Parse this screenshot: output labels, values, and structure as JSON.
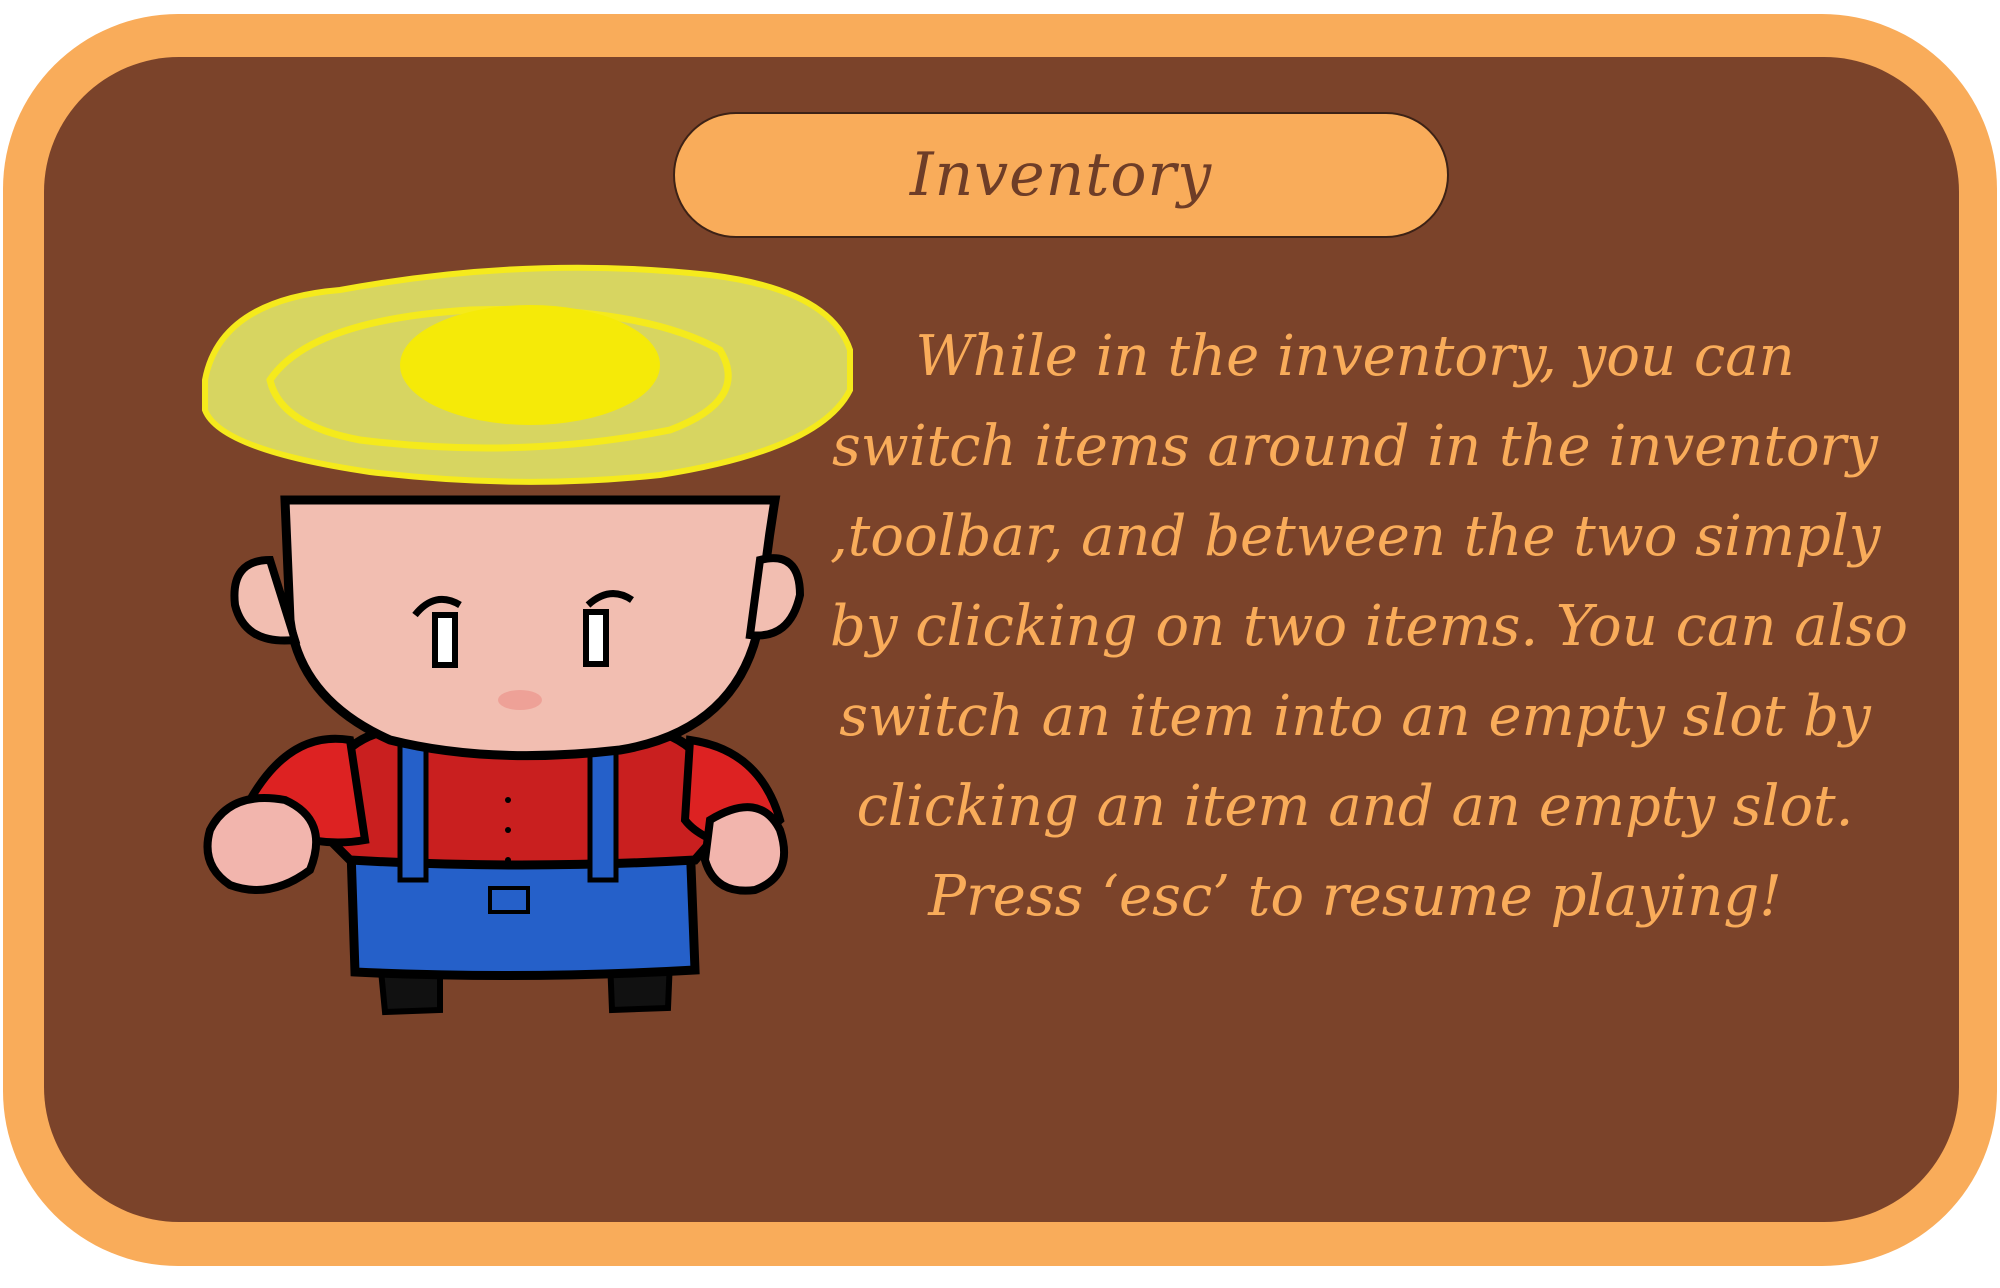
{
  "dialog": {
    "title": "Inventory",
    "lines": [
      "While in the inventory, you can",
      "switch items around in the inventory",
      ",toolbar, and between the two simply",
      "by clicking on two items. You can also",
      "switch an item into an empty slot by",
      "clicking an item and an empty slot.",
      "Press ‘esc’ to resume playing!"
    ]
  },
  "colors": {
    "frame": "#f9ac5a",
    "panel": "#7b432a",
    "text": "#f9ac5a",
    "title_text": "#6e3d27"
  },
  "illustration": {
    "icon": "farmer-character-icon"
  }
}
